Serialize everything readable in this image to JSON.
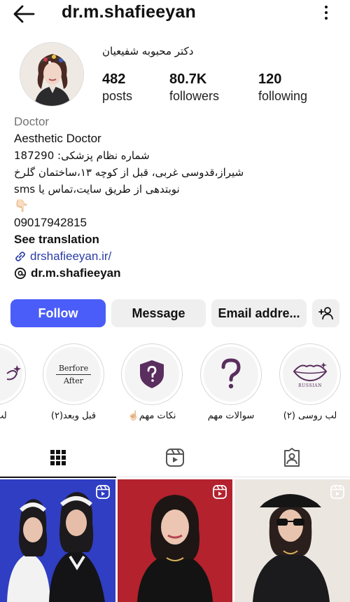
{
  "header": {
    "username": "dr.m.shafieeyan"
  },
  "profile": {
    "full_name": "دکتر محبوبه شفیعیان",
    "stats": [
      {
        "value": "482",
        "label": "posts"
      },
      {
        "value": "80.7K",
        "label": "followers"
      },
      {
        "value": "120",
        "label": "following"
      }
    ]
  },
  "bio": {
    "category": "Doctor",
    "lines": [
      "Aesthetic Doctor",
      "شماره نظام پزشکی: 187290",
      "شیراز،قدوسی غربی، قبل از کوچه ۱۳،ساختمان گلرخ",
      "نوبتدهی از طریق سایت،تماس یا sms",
      "👇🏻",
      "09017942815"
    ],
    "see_translation": "See translation",
    "link": "drshafieeyan.ir/",
    "threads_handle": "dr.m.shafieeyan"
  },
  "actions": {
    "follow": "Follow",
    "message": "Message",
    "email": "Email addre..."
  },
  "highlights": [
    {
      "label": "لب رو",
      "icon": "lips-icon"
    },
    {
      "label": "قبل وبعد(۲)",
      "icon": "before-after-icon",
      "text1": "Berfore",
      "text2": "After"
    },
    {
      "label": "نکات مهم☝🏻",
      "icon": "shield-question-icon"
    },
    {
      "label": "سوالات مهم",
      "icon": "question-mark-icon"
    },
    {
      "label": "لب روسی (۲)",
      "icon": "russian-lips-icon",
      "text1": "RUSSIAN"
    }
  ],
  "tabs": [
    "grid-icon",
    "reels-icon",
    "tagged-icon"
  ],
  "colors": {
    "follow_bg": "#4a5df9",
    "link": "#2b3da7",
    "highlight_purple": "#5a2e5e",
    "tile1_bg": "#2f3ec2",
    "tile2_bg": "#b3222d",
    "tile3_bg": "#ece6e1"
  }
}
